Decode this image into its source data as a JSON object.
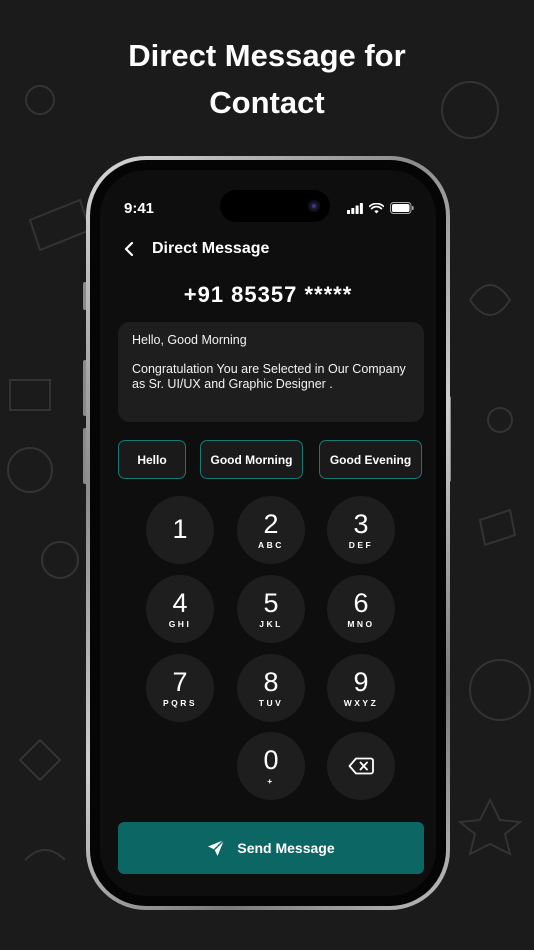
{
  "headline": {
    "line1": "Direct Message for",
    "line2": "Contact"
  },
  "status_bar": {
    "time": "9:41"
  },
  "nav": {
    "title": "Direct Message"
  },
  "phone_number": "+91 85357 *****",
  "message": {
    "greeting": "Hello, Good Morning",
    "body": "Congratulation You are Selected in Our Company as Sr. UI/UX and Graphic Designer ."
  },
  "quick_replies": [
    "Hello",
    "Good Morning",
    "Good Evening"
  ],
  "keypad": [
    {
      "digit": "1",
      "letters": ""
    },
    {
      "digit": "2",
      "letters": "ABC"
    },
    {
      "digit": "3",
      "letters": "DEF"
    },
    {
      "digit": "4",
      "letters": "GHI"
    },
    {
      "digit": "5",
      "letters": "JKL"
    },
    {
      "digit": "6",
      "letters": "MNO"
    },
    {
      "digit": "7",
      "letters": "PQRS"
    },
    {
      "digit": "8",
      "letters": "TUV"
    },
    {
      "digit": "9",
      "letters": "WXYZ"
    },
    {
      "digit": "0",
      "letters": "+"
    }
  ],
  "send_button": {
    "label": "Send Message"
  },
  "colors": {
    "accent": "#0b6664",
    "chip_border": "#157a74",
    "background": "#1b1b1b"
  },
  "icons": [
    "back-chevron-icon",
    "signal-icon",
    "wifi-icon",
    "battery-icon",
    "backspace-icon",
    "send-icon"
  ]
}
